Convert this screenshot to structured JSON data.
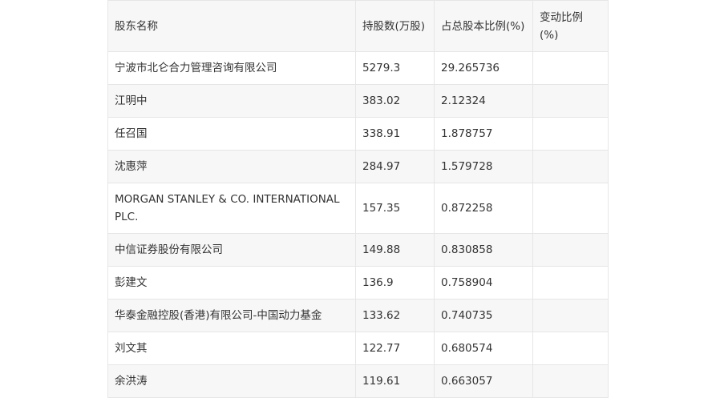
{
  "table": {
    "headers": [
      "股东名称",
      "持股数(万股)",
      "占总股本比例(%)",
      "变动比例(%)"
    ],
    "rows": [
      [
        "宁波市北仑合力管理咨询有限公司",
        "5279.3",
        "29.265736",
        ""
      ],
      [
        "江明中",
        "383.02",
        "2.12324",
        ""
      ],
      [
        "任召国",
        "338.91",
        "1.878757",
        ""
      ],
      [
        "沈惠萍",
        "284.97",
        "1.579728",
        ""
      ],
      [
        "MORGAN STANLEY & CO. INTERNATIONAL PLC.",
        "157.35",
        "0.872258",
        ""
      ],
      [
        "中信证券股份有限公司",
        "149.88",
        "0.830858",
        ""
      ],
      [
        "彭建文",
        "136.9",
        "0.758904",
        ""
      ],
      [
        "华泰金融控股(香港)有限公司-中国动力基金",
        "133.62",
        "0.740735",
        ""
      ],
      [
        "刘文其",
        "122.77",
        "0.680574",
        ""
      ],
      [
        "余洪涛",
        "119.61",
        "0.663057",
        ""
      ]
    ]
  }
}
